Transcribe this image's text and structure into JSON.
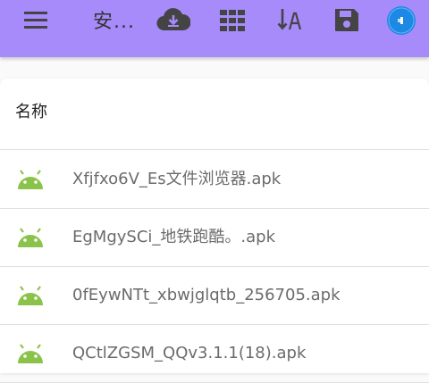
{
  "toolbar": {
    "title": "安...",
    "icons": [
      "menu-icon",
      "cloud-download-icon",
      "grid-view-icon",
      "sort-alpha-icon",
      "save-icon",
      "avatar"
    ]
  },
  "colors": {
    "toolbar": "#a78bfa",
    "android": "#8bc34a",
    "avatar": "#1e88e5"
  },
  "list": {
    "header": "名称",
    "items": [
      {
        "name": "Xfjfxo6V_Es文件浏览器.apk",
        "icon": "android-icon"
      },
      {
        "name": "EgMgySCi_地铁跑酷。.apk",
        "icon": "android-icon"
      },
      {
        "name": "0fEywNTt_xbwjglqtb_256705.apk",
        "icon": "android-icon"
      },
      {
        "name": "QCtlZGSM_QQv3.1.1(18).apk",
        "icon": "android-icon"
      }
    ]
  }
}
